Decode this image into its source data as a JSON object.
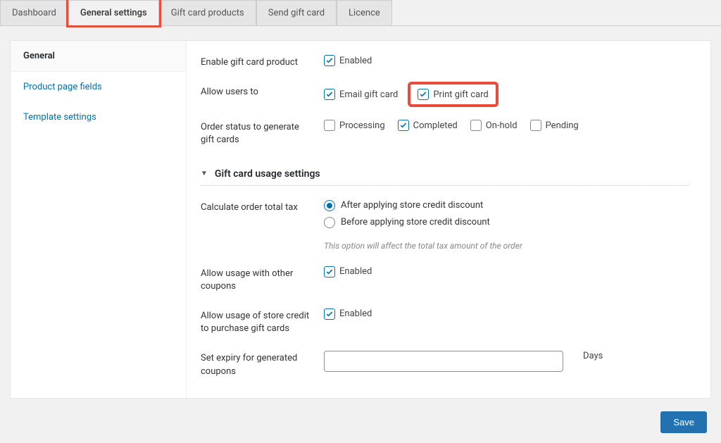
{
  "tabs": {
    "dashboard": "Dashboard",
    "general_settings": "General settings",
    "gift_card_products": "Gift card products",
    "send_gift_card": "Send gift card",
    "licence": "Licence"
  },
  "sidebar": {
    "general": "General",
    "product_page_fields": "Product page fields",
    "template_settings": "Template settings"
  },
  "form": {
    "enable_product": {
      "label": "Enable gift card product",
      "enabled": "Enabled"
    },
    "allow_users": {
      "label": "Allow users to",
      "email": "Email gift card",
      "print": "Print gift card"
    },
    "order_status": {
      "label": "Order status to generate gift cards",
      "processing": "Processing",
      "completed": "Completed",
      "onhold": "On-hold",
      "pending": "Pending"
    },
    "section_usage": "Gift card usage settings",
    "calc_tax": {
      "label": "Calculate order total tax",
      "after": "After applying store credit discount",
      "before": "Before applying store credit discount",
      "help": "This option will affect the total tax amount of the order"
    },
    "allow_coupons": {
      "label": "Allow usage with other coupons",
      "enabled": "Enabled"
    },
    "allow_store_credit": {
      "label": "Allow usage of store credit to purchase gift cards",
      "enabled": "Enabled"
    },
    "expiry": {
      "label": "Set expiry for generated coupons",
      "unit": "Days",
      "value": ""
    }
  },
  "footer": {
    "save": "Save"
  }
}
